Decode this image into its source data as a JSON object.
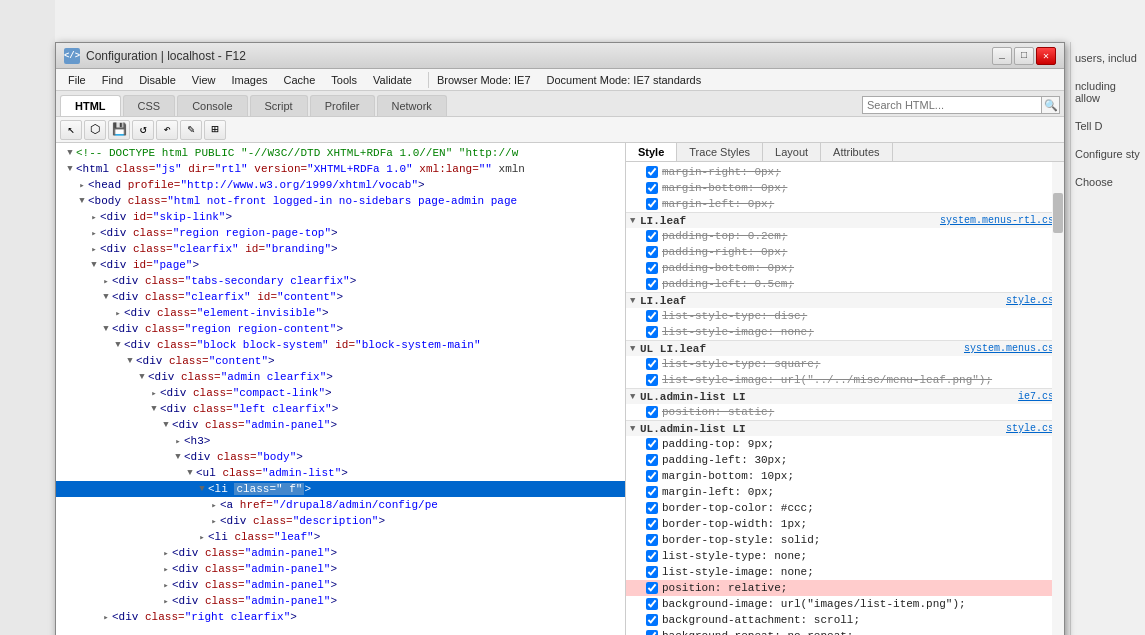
{
  "window": {
    "title": "Configuration | localhost - F12",
    "icon_label": "</>",
    "controls": [
      "_",
      "□",
      "✕"
    ]
  },
  "menu_bar": {
    "items": [
      "File",
      "Find",
      "Disable",
      "View",
      "Images",
      "Cache",
      "Tools",
      "Validate"
    ],
    "browser_mode": "Browser Mode: IE7",
    "document_mode": "Document Mode: IE7 standards"
  },
  "tabs": {
    "items": [
      "HTML",
      "CSS",
      "Console",
      "Script",
      "Profiler",
      "Network"
    ],
    "active": "HTML"
  },
  "search": {
    "placeholder": "Search HTML..."
  },
  "style_tabs": {
    "items": [
      "Style",
      "Trace Styles",
      "Layout",
      "Attributes"
    ],
    "active": "Style"
  },
  "dom_tree": {
    "lines": [
      {
        "indent": 0,
        "text": "<!-- DOCTYPE html PUBLIC \"-//W3C//DTD XHTML+RDFa 1.0//EN\"  \"http://w",
        "type": "comment"
      },
      {
        "indent": 0,
        "text": "<html class=\"js\" dir=\"rtl\" version=\"XHTML+RDFa 1.0\" xml:lang=\"\" xmln",
        "type": "tag",
        "expand": true
      },
      {
        "indent": 1,
        "text": "<head profile=\"http://www.w3.org/1999/xhtml/vocab\">",
        "type": "tag",
        "expand": true
      },
      {
        "indent": 1,
        "text": "<body class=\"html not-front logged-in no-sidebars page-admin page",
        "type": "tag",
        "expand": true
      },
      {
        "indent": 2,
        "text": "<div id=\"skip-link\">",
        "type": "tag",
        "expand": true
      },
      {
        "indent": 2,
        "text": "<div class=\"region region-page-top\">",
        "type": "tag",
        "expand": true
      },
      {
        "indent": 2,
        "text": "<div class=\"clearfix\" id=\"branding\">",
        "type": "tag",
        "expand": true
      },
      {
        "indent": 2,
        "text": "<div id=\"page\">",
        "type": "tag",
        "expand": true
      },
      {
        "indent": 3,
        "text": "<div class=\"tabs-secondary clearfix\">",
        "type": "tag",
        "expand": true
      },
      {
        "indent": 3,
        "text": "<div class=\"clearfix\" id=\"content\">",
        "type": "tag",
        "expand": true
      },
      {
        "indent": 4,
        "text": "<div class=\"element-invisible\">",
        "type": "tag",
        "expand": true
      },
      {
        "indent": 3,
        "text": "<div class=\"region region-content\">",
        "type": "tag",
        "expand": true
      },
      {
        "indent": 4,
        "text": "<div class=\"block block-system\" id=\"block-system-main\"",
        "type": "tag",
        "expand": true
      },
      {
        "indent": 5,
        "text": "<div class=\"content\">",
        "type": "tag",
        "expand": true
      },
      {
        "indent": 6,
        "text": "<div class=\"admin clearfix\">",
        "type": "tag",
        "expand": true
      },
      {
        "indent": 7,
        "text": "<div class=\"compact-link\">",
        "type": "tag",
        "expand": true
      },
      {
        "indent": 7,
        "text": "<div class=\"left clearfix\">",
        "type": "tag",
        "expand": true
      },
      {
        "indent": 8,
        "text": "<div class=\"admin-panel\">",
        "type": "tag",
        "expand": true
      },
      {
        "indent": 9,
        "text": "<h3>",
        "type": "tag",
        "expand": true
      },
      {
        "indent": 9,
        "text": "<div class=\"body\">",
        "type": "tag",
        "expand": true
      },
      {
        "indent": 10,
        "text": "<ul class=\"admin-list\">",
        "type": "tag",
        "expand": true
      },
      {
        "indent": 11,
        "text": "<li class=\"    f\">",
        "type": "tag",
        "selected": true,
        "expand": true
      },
      {
        "indent": 12,
        "text": "<a href=\"/drupal8/admin/config/pe",
        "type": "tag",
        "expand": true
      },
      {
        "indent": 12,
        "text": "<div class=\"description\">",
        "type": "tag",
        "expand": true
      },
      {
        "indent": 11,
        "text": "<li class=\"leaf\">",
        "type": "tag",
        "expand": true
      },
      {
        "indent": 7,
        "text": "<div class=\"admin-panel\">",
        "type": "tag",
        "expand": true
      },
      {
        "indent": 7,
        "text": "<div class=\"admin-panel\">",
        "type": "tag",
        "expand": true
      },
      {
        "indent": 7,
        "text": "<div class=\"admin-panel\">",
        "type": "tag",
        "expand": true
      },
      {
        "indent": 7,
        "text": "<div class=\"admin-panel\">",
        "type": "tag",
        "expand": true
      },
      {
        "indent": 3,
        "text": "<div class=\"right clearfix\">",
        "type": "tag",
        "expand": true
      }
    ]
  },
  "css_rules": [
    {
      "selector": "",
      "source": "",
      "properties": [
        {
          "checked": true,
          "text": "margin-right: 0px;",
          "strikethrough": true
        },
        {
          "checked": true,
          "text": "margin-bottom: 0px;",
          "strikethrough": true
        },
        {
          "checked": true,
          "text": "margin-left: 0px;",
          "strikethrough": true
        }
      ]
    },
    {
      "selector": "LI.leaf",
      "source": "system.menus-rtl.css",
      "properties": [
        {
          "checked": true,
          "text": "padding-top: 0.2em;",
          "strikethrough": true
        },
        {
          "checked": true,
          "text": "padding-right: 0px;",
          "strikethrough": true
        },
        {
          "checked": true,
          "text": "padding-bottom: 0px;",
          "strikethrough": true
        },
        {
          "checked": true,
          "text": "padding-left: 0.5em;",
          "strikethrough": true
        }
      ]
    },
    {
      "selector": "LI.leaf",
      "source": "style.css",
      "properties": [
        {
          "checked": true,
          "text": "list-style-type: disc;",
          "strikethrough": true
        },
        {
          "checked": true,
          "text": "list-style-image: none;",
          "strikethrough": true
        }
      ]
    },
    {
      "selector": "UL LI.leaf",
      "source": "system.menus.css",
      "properties": [
        {
          "checked": true,
          "text": "list-style-type: square;",
          "strikethrough": true
        },
        {
          "checked": true,
          "text": "list-style-image: url(\"../../misc/menu-leaf.png\");",
          "strikethrough": true
        }
      ]
    },
    {
      "selector": "UL.admin-list LI",
      "source": "ie7.css",
      "properties": [
        {
          "checked": true,
          "text": "position: static;",
          "strikethrough": true
        }
      ]
    },
    {
      "selector": "UL.admin-list LI",
      "source": "style.css",
      "properties": [
        {
          "checked": true,
          "text": "padding-top: 9px;"
        },
        {
          "checked": true,
          "text": "padding-left: 30px;"
        },
        {
          "checked": true,
          "text": "margin-bottom: 10px;"
        },
        {
          "checked": true,
          "text": "margin-left: 0px;"
        },
        {
          "checked": true,
          "text": "border-top-color: #ccc;"
        },
        {
          "checked": true,
          "text": "border-top-width: 1px;"
        },
        {
          "checked": true,
          "text": "border-top-style: solid;"
        },
        {
          "checked": true,
          "text": "list-style-type: none;"
        },
        {
          "checked": true,
          "text": "list-style-image: none;"
        },
        {
          "checked": true,
          "text": "position: relative;",
          "highlight": true
        },
        {
          "checked": true,
          "text": "background-image: url(\"images/list-item.png\");"
        },
        {
          "checked": true,
          "text": "background-attachment: scroll;"
        },
        {
          "checked": true,
          "text": "background-repeat: no-repeat;"
        }
      ]
    }
  ],
  "right_sidebar": {
    "items": [
      "users, includ",
      "ncluding allow",
      "Tell D",
      "Configure sty",
      "Choose"
    ]
  },
  "bottom_text": "right"
}
